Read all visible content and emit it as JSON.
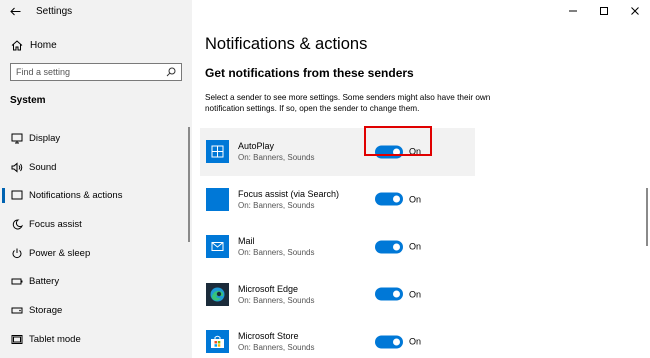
{
  "app": {
    "title": "Settings"
  },
  "sidebar": {
    "home_label": "Home",
    "search_placeholder": "Find a setting",
    "section_label": "System",
    "items": [
      {
        "label": "Display",
        "icon": "display-icon"
      },
      {
        "label": "Sound",
        "icon": "speaker-icon"
      },
      {
        "label": "Notifications & actions",
        "icon": "notification-icon",
        "active": true
      },
      {
        "label": "Focus assist",
        "icon": "moon-icon"
      },
      {
        "label": "Power & sleep",
        "icon": "power-icon"
      },
      {
        "label": "Battery",
        "icon": "battery-icon"
      },
      {
        "label": "Storage",
        "icon": "storage-icon"
      },
      {
        "label": "Tablet mode",
        "icon": "tablet-icon"
      }
    ]
  },
  "main": {
    "title": "Notifications & actions",
    "subtitle": "Get notifications from these senders",
    "description": "Select a sender to see more settings. Some senders might also have their own notification settings. If so, open the sender to change them.",
    "senders": [
      {
        "name": "AutoPlay",
        "status": "On: Banners, Sounds",
        "toggle": "On",
        "icon": "autoplay-icon"
      },
      {
        "name": "Focus assist (via Search)",
        "status": "On: Banners, Sounds",
        "toggle": "On",
        "icon": "blank-app-icon"
      },
      {
        "name": "Mail",
        "status": "On: Banners, Sounds",
        "toggle": "On",
        "icon": "mail-icon"
      },
      {
        "name": "Microsoft Edge",
        "status": "On: Banners, Sounds",
        "toggle": "On",
        "icon": "edge-icon"
      },
      {
        "name": "Microsoft Store",
        "status": "On: Banners, Sounds",
        "toggle": "On",
        "icon": "store-icon"
      }
    ]
  },
  "colors": {
    "accent": "#0078d7",
    "sidebar_bg": "#f2f2f2",
    "highlight_box": "#e00000"
  }
}
